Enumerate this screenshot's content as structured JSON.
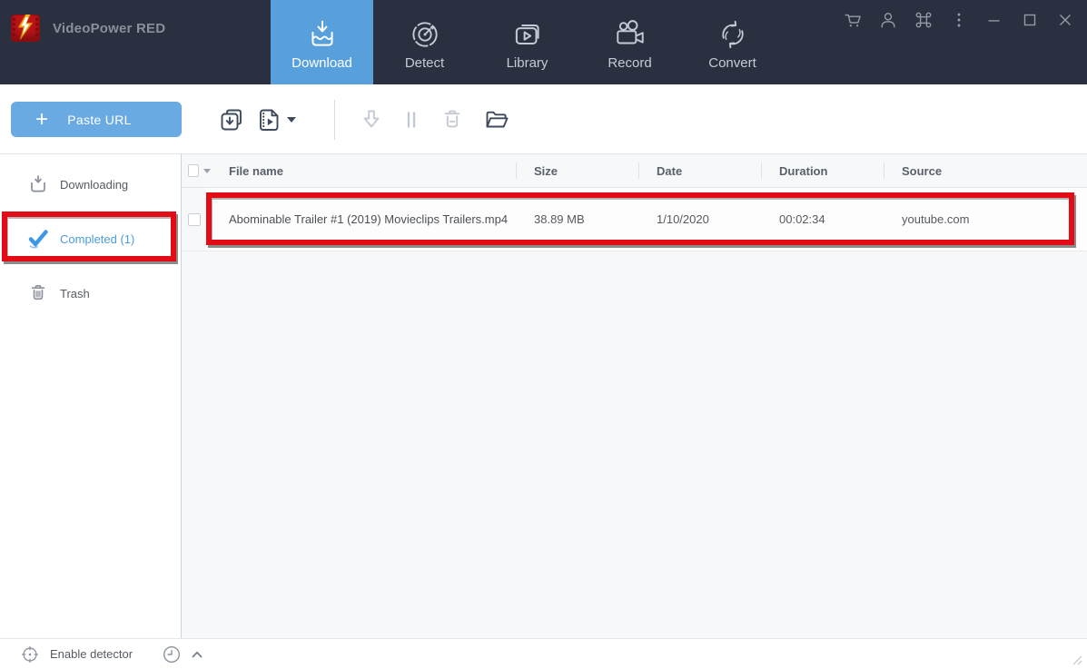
{
  "app": {
    "title": "VideoPower RED"
  },
  "header": {
    "tabs": [
      {
        "label": "Download",
        "active": true
      },
      {
        "label": "Detect",
        "active": false
      },
      {
        "label": "Library",
        "active": false
      },
      {
        "label": "Record",
        "active": false
      },
      {
        "label": "Convert",
        "active": false
      }
    ],
    "window_icons": [
      "cart-icon",
      "user-icon",
      "command-icon",
      "kebab-menu-icon",
      "minimize-icon",
      "maximize-icon",
      "close-icon"
    ]
  },
  "toolbar": {
    "paste_url_label": "Paste URL",
    "plus_glyph": "+",
    "icons": [
      "batch-download-icon",
      "video-format-icon",
      "resume-download-icon",
      "pause-icon",
      "delete-icon",
      "open-folder-icon"
    ]
  },
  "sidebar": {
    "items": [
      {
        "label": "Downloading",
        "active": false
      },
      {
        "label": "Completed (1)",
        "active": true,
        "annotated": true
      },
      {
        "label": "Trash",
        "active": false
      }
    ]
  },
  "table": {
    "columns": [
      "File name",
      "Size",
      "Date",
      "Duration",
      "Source"
    ],
    "rows": [
      {
        "file_name": "Abominable Trailer #1 (2019)  Movieclips Trailers.mp4",
        "size": "38.89 MB",
        "date": "1/10/2020",
        "duration": "00:02:34",
        "source": "youtube.com",
        "annotated": true
      }
    ]
  },
  "footer": {
    "enable_detector_label": "Enable detector"
  },
  "colors": {
    "header_bg": "#2a3040",
    "active_tab_blue": "#58a0dc",
    "paste_button_blue": "#6aaae3",
    "sidebar_active_blue": "#4b9ddf",
    "annotation_red": "#e30b16",
    "content_bg": "#f7f8f9"
  }
}
